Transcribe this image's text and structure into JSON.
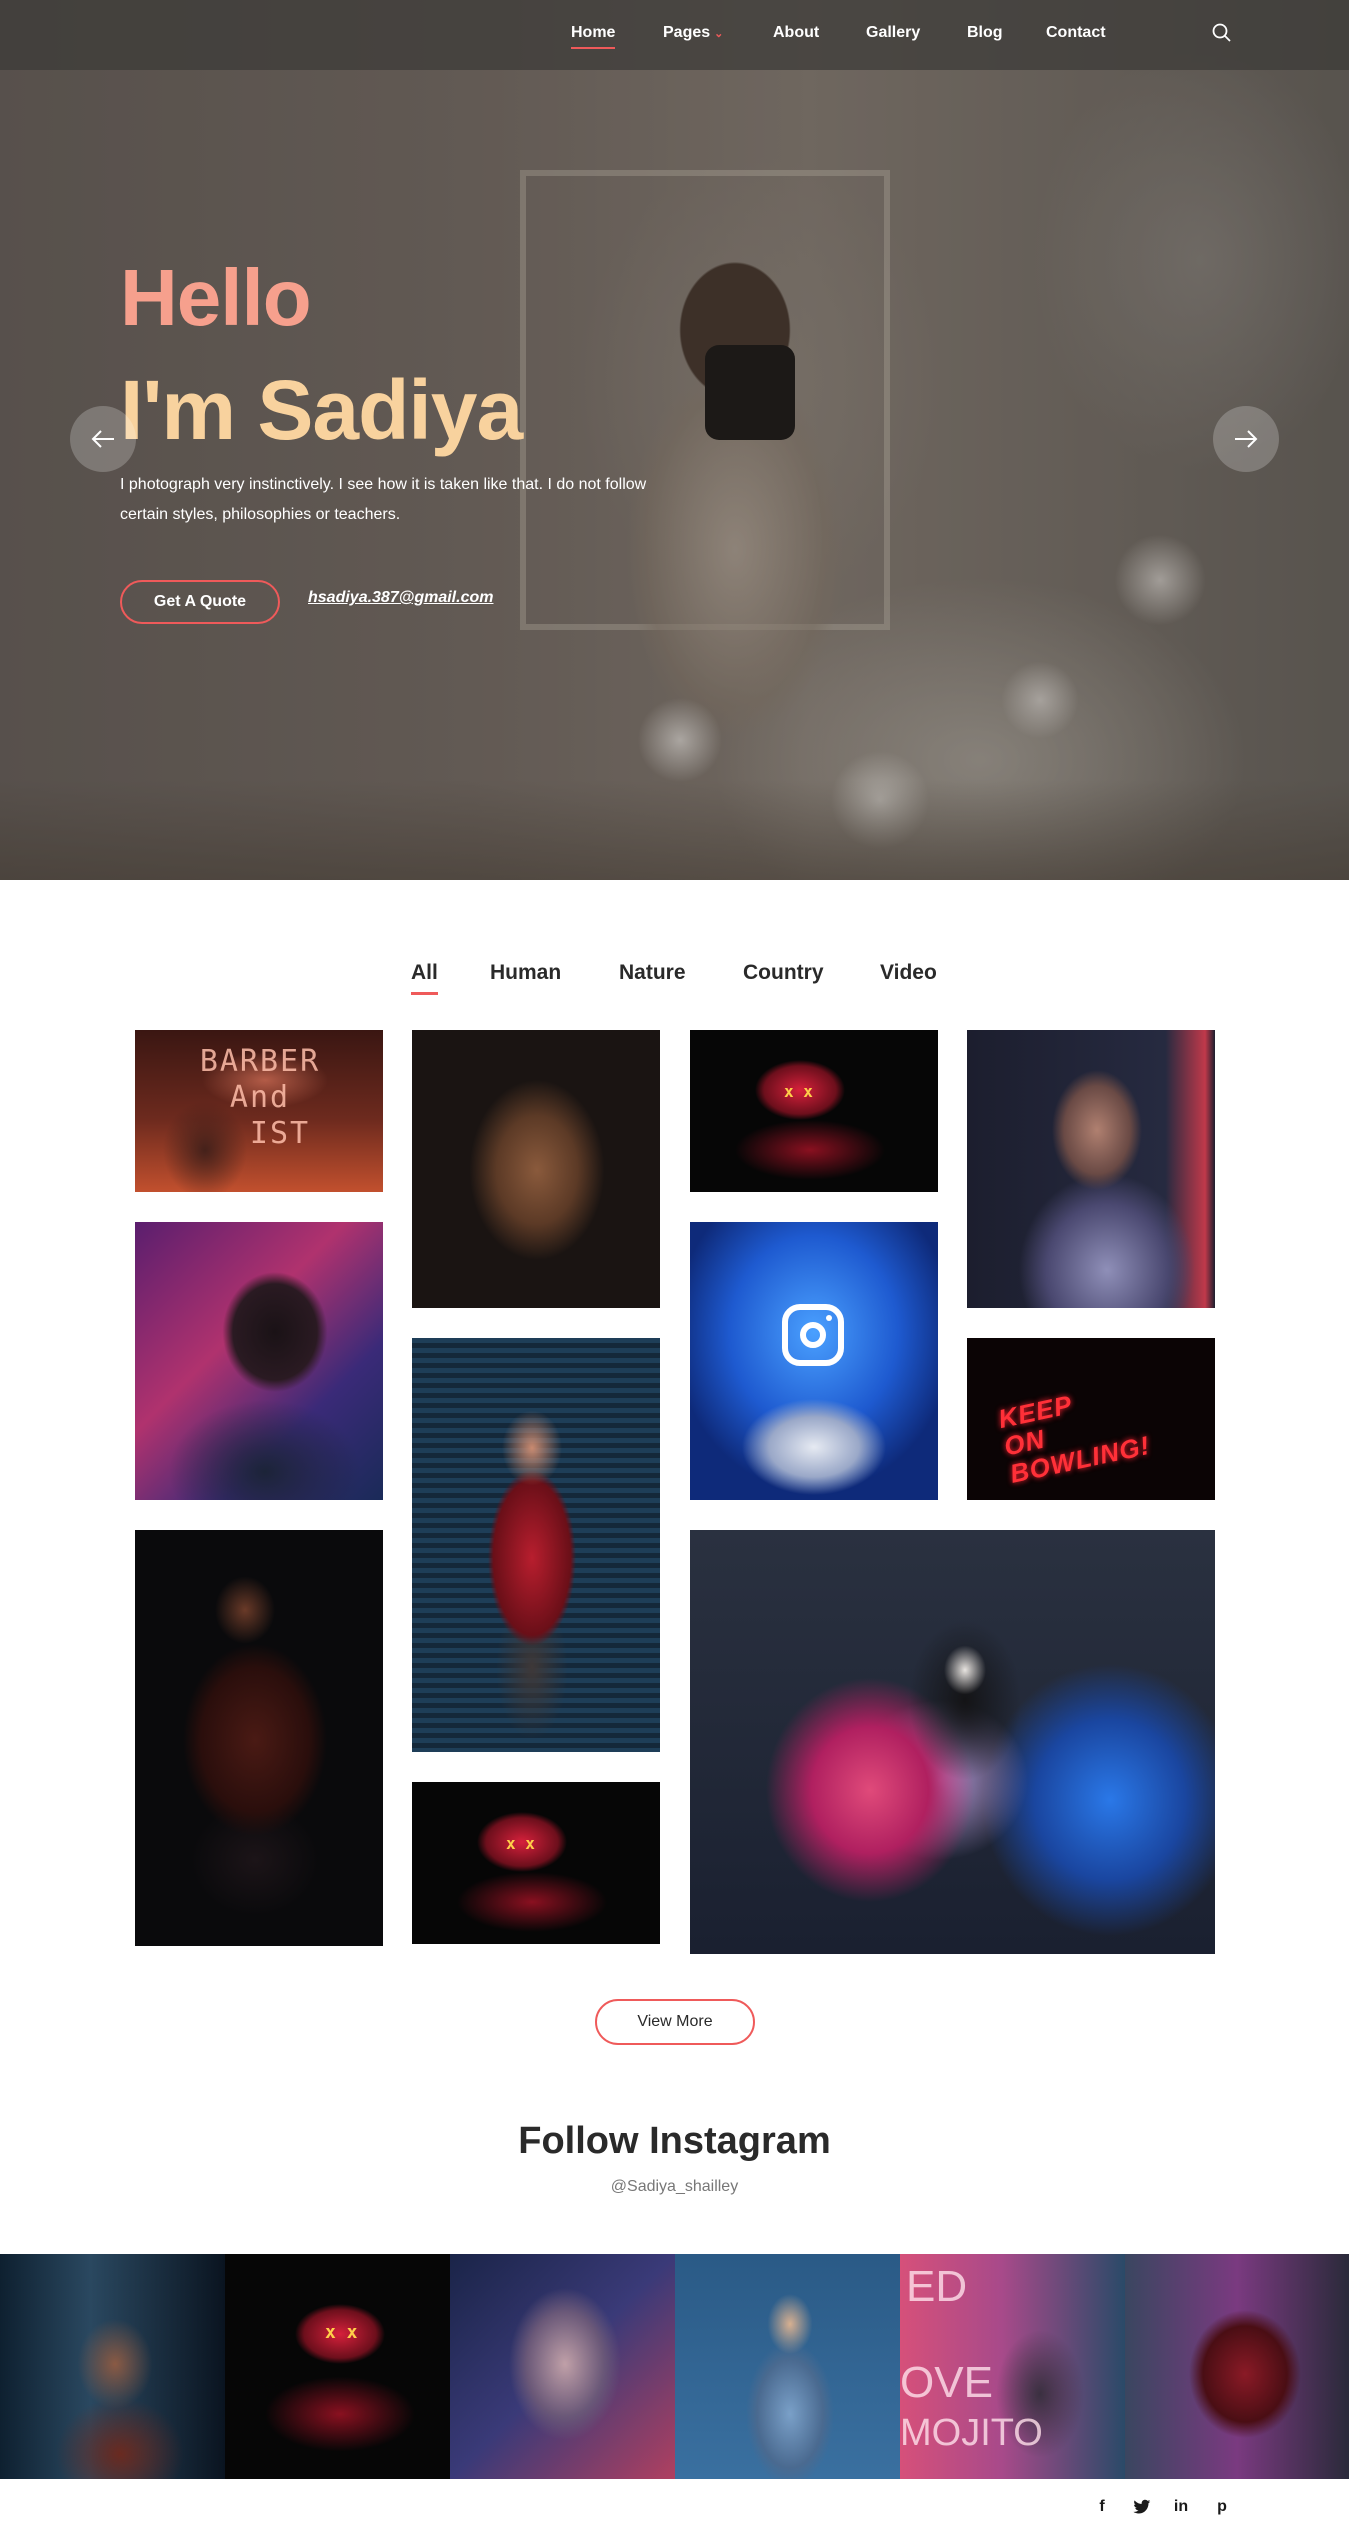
{
  "nav": {
    "items": [
      {
        "label": "Home",
        "active": true
      },
      {
        "label": "Pages",
        "has_dropdown": true
      },
      {
        "label": "About"
      },
      {
        "label": "Gallery"
      },
      {
        "label": "Blog"
      },
      {
        "label": "Contact"
      }
    ],
    "search_icon": "search-icon"
  },
  "hero": {
    "greeting": "Hello",
    "name_line": "I'm Sadiya",
    "description": "I photograph very instinctively. I see how it is taken like that. I do not follow certain styles, philosophies or teachers.",
    "cta_label": "Get A Quote",
    "email": "hsadiya.387@gmail.com",
    "prev_icon": "arrow-left-icon",
    "next_icon": "arrow-right-icon",
    "colors": {
      "greeting": "#f6a08d",
      "name": "#f8d29e",
      "accent": "#ef5a5a"
    }
  },
  "filters": {
    "tabs": [
      {
        "label": "All",
        "active": true
      },
      {
        "label": "Human"
      },
      {
        "label": "Nature"
      },
      {
        "label": "Country"
      },
      {
        "label": "Video"
      }
    ]
  },
  "gallery": {
    "barber_sign": [
      "BARBER",
      "And",
      "IST"
    ],
    "neon_sign": [
      "KEEP",
      "ON",
      "BOWLING!"
    ],
    "mask_eyes": "x x"
  },
  "view_more_label": "View More",
  "instagram": {
    "title": "Follow Instagram",
    "handle": "@Sadiya_shailley",
    "strip_neon": [
      "ED",
      "OVE",
      "MOJITO"
    ]
  },
  "social": {
    "icons": [
      "facebook-icon",
      "twitter-icon",
      "linkedin-icon",
      "pinterest-icon"
    ],
    "glyphs": [
      "f",
      "t",
      "in",
      "p"
    ]
  }
}
